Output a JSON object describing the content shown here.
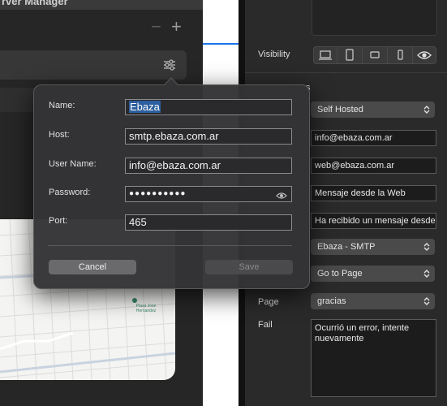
{
  "server_manager": {
    "title": "rver Manager",
    "minus": "−",
    "plus": "+"
  },
  "map": {
    "poi_label": "Plaza Jose Hernandez"
  },
  "inspector": {
    "visibility_label": "Visibility",
    "visibility_buttons": [
      "desktop-icon",
      "tablet-portrait-icon",
      "tablet-landscape-icon",
      "phone-icon",
      "eye-icon"
    ],
    "rows": {
      "server_popup": "Self Hosted",
      "from_field": "info@ebaza.com.ar",
      "to_field": "web@ebaza.com.ar",
      "subject_field": "Mensaje desde la Web",
      "message_field": "Ha recibido un mensaje desde",
      "smtp_popup": "Ebaza - SMTP",
      "action_popup": "Go to Page",
      "page_label": "Page",
      "page_popup": "gracias",
      "fail_label": "Fail",
      "fail_text": "Ocurrió un error, intente nuevamente"
    },
    "partial_label": "s"
  },
  "dialog": {
    "name_label": "Name:",
    "name_value": "Ebaza",
    "host_label": "Host:",
    "host_value": "smtp.ebaza.com.ar",
    "user_label": "User Name:",
    "user_value": "info@ebaza.com.ar",
    "password_label": "Password:",
    "password_value": "●●●●●●●●●●",
    "port_label": "Port:",
    "port_value": "465",
    "cancel_label": "Cancel",
    "save_label": "Save"
  },
  "colors": {
    "accent_blue": "#1a73e8",
    "selection": "#2c5f9e"
  }
}
